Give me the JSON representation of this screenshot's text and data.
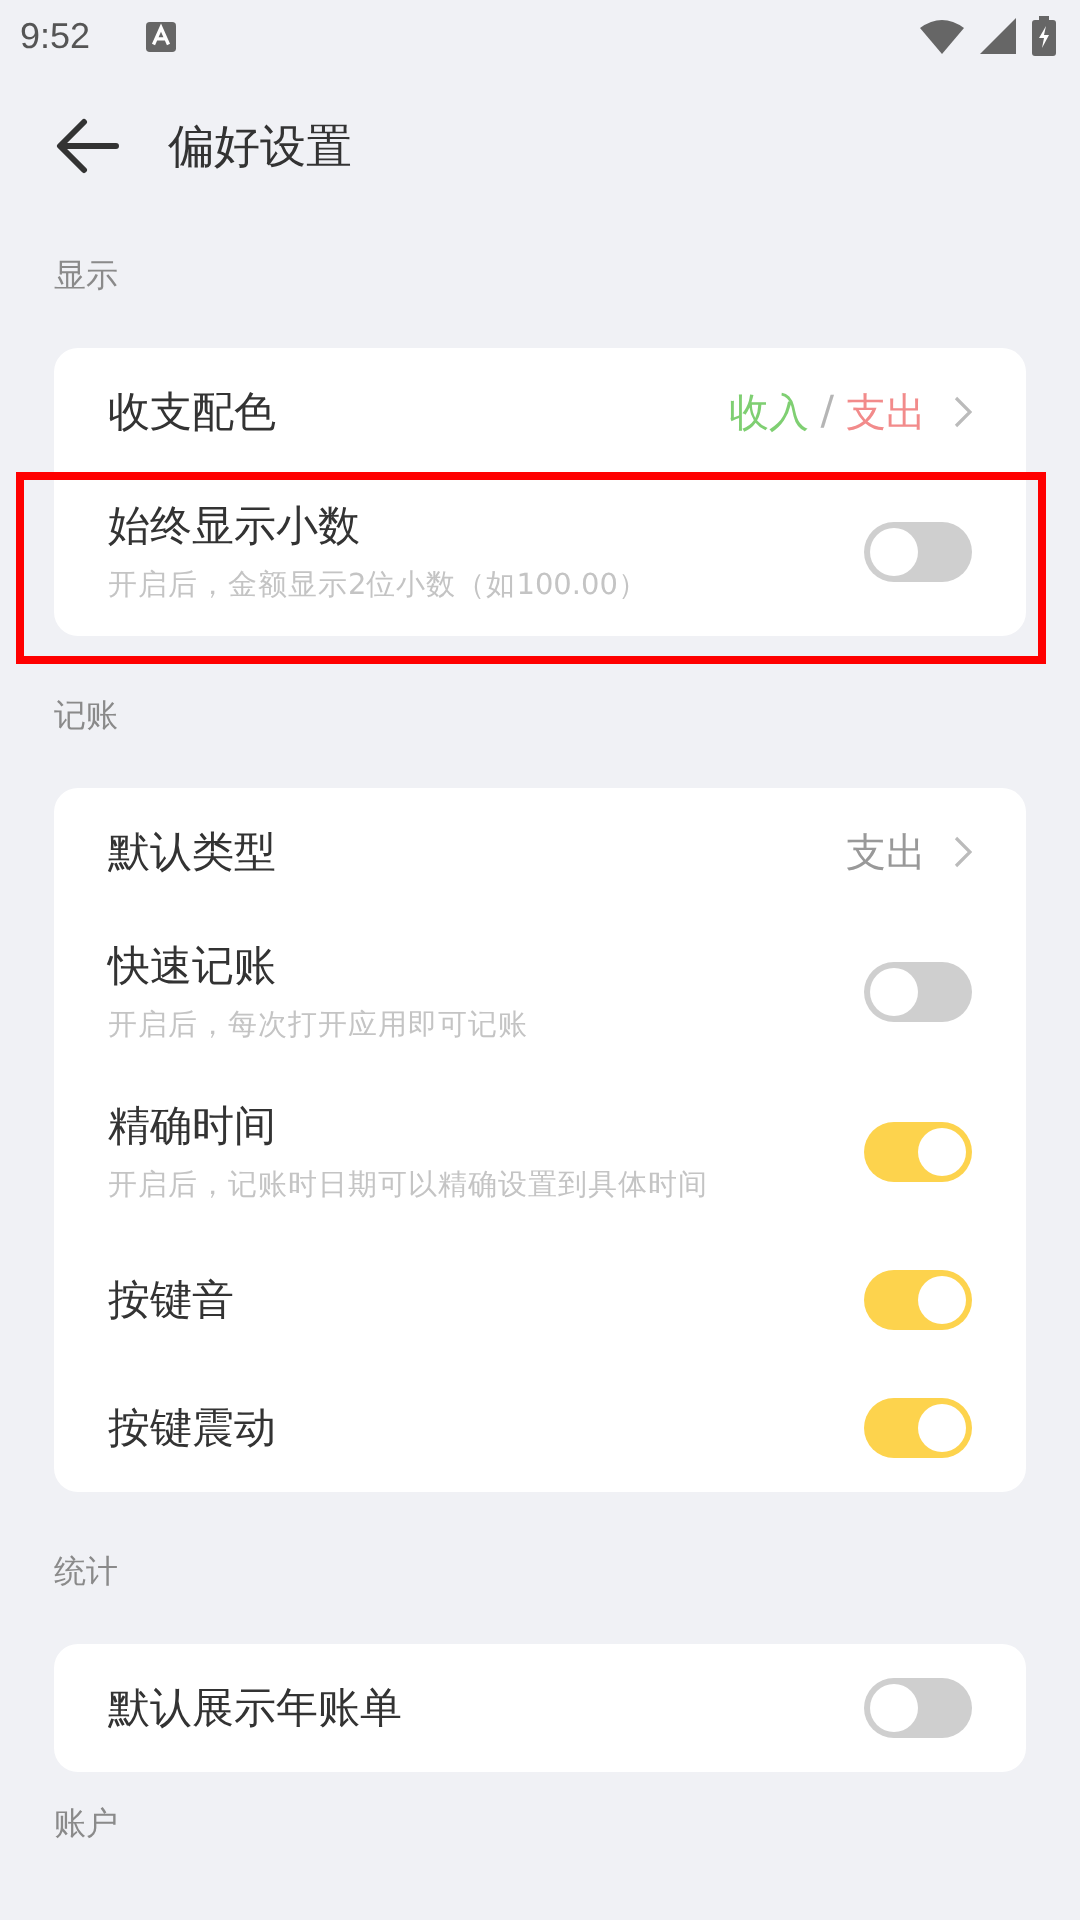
{
  "status_bar": {
    "time": "9:52"
  },
  "header": {
    "title": "偏好设置"
  },
  "sections": [
    {
      "title": "显示",
      "items": [
        {
          "kind": "link",
          "label": "收支配色",
          "value_parts": [
            {
              "text": "收入",
              "color": "#7fcf72"
            },
            {
              "text": "/",
              "color": "#b5b5b5"
            },
            {
              "text": "支出",
              "color": "#f28b8b"
            }
          ]
        },
        {
          "kind": "toggle",
          "label": "始终显示小数",
          "subtitle": "开启后，金额显示2位小数（如100.00）",
          "on": false,
          "highlighted": true
        }
      ]
    },
    {
      "title": "记账",
      "items": [
        {
          "kind": "link",
          "label": "默认类型",
          "value_parts": [
            {
              "text": "支出",
              "color": "#999999"
            }
          ]
        },
        {
          "kind": "toggle",
          "label": "快速记账",
          "subtitle": "开启后，每次打开应用即可记账",
          "on": false,
          "highlighted": false
        },
        {
          "kind": "toggle",
          "label": "精确时间",
          "subtitle": "开启后，记账时日期可以精确设置到具体时间",
          "on": true,
          "highlighted": false
        },
        {
          "kind": "toggle",
          "label": "按键音",
          "on": true,
          "highlighted": false
        },
        {
          "kind": "toggle",
          "label": "按键震动",
          "on": true,
          "highlighted": false
        }
      ]
    },
    {
      "title": "统计",
      "items": [
        {
          "kind": "toggle",
          "label": "默认展示年账单",
          "on": false,
          "highlighted": false
        }
      ]
    },
    {
      "title": "账户"
    }
  ]
}
